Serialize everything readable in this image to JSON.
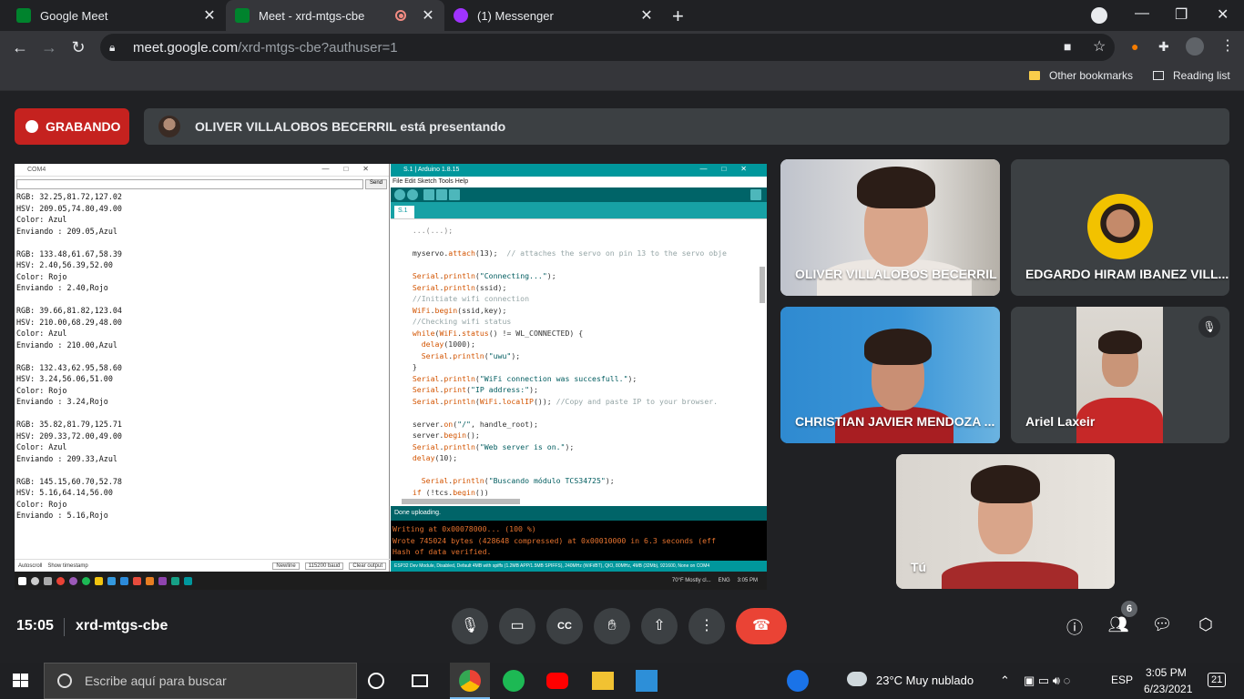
{
  "browser": {
    "tabs": [
      {
        "title": "Google Meet",
        "active": false
      },
      {
        "title": "Meet - xrd-mtgs-cbe",
        "active": true
      },
      {
        "title": "(1) Messenger",
        "active": false
      }
    ],
    "url_host": "meet.google.com",
    "url_path": "/xrd-mtgs-cbe?authuser=1",
    "bookmarks": {
      "other": "Other bookmarks",
      "reading_list": "Reading list"
    }
  },
  "meet": {
    "recording_label": "GRABANDO",
    "presenting_text": "OLIVER VILLALOBOS BECERRIL está presentando",
    "time": "15:05",
    "meeting_code": "xrd-mtgs-cbe",
    "participant_count": "6",
    "participants": [
      {
        "name": "OLIVER VILLALOBOS BECERRIL"
      },
      {
        "name": "EDGARDO HIRAM IBANEZ VILL..."
      },
      {
        "name": "CHRISTIAN JAVIER MENDOZA ..."
      },
      {
        "name": "Ariel Laxeir"
      },
      {
        "name": "Tú"
      }
    ],
    "colors": {
      "record_red": "#c5221f",
      "end_call": "#ea4335"
    }
  },
  "shared_screen": {
    "serial_title": "COM4",
    "send_label": "Send",
    "serial_output": "RGB: 32.25,81.72,127.02\nHSV: 209.05,74.80,49.00\nColor: Azul\nEnviando : 209.05,Azul\n\nRGB: 133.48,61.67,58.39\nHSV: 2.40,56.39,52.00\nColor: Rojo\nEnviando : 2.40,Rojo\n\nRGB: 39.66,81.82,123.04\nHSV: 210.00,68.29,48.00\nColor: Azul\nEnviando : 210.00,Azul\n\nRGB: 132.43,62.95,58.60\nHSV: 3.24,56.06,51.00\nColor: Rojo\nEnviando : 3.24,Rojo\n\nRGB: 35.82,81.79,125.71\nHSV: 209.33,72.00,49.00\nColor: Azul\nEnviando : 209.33,Azul\n\nRGB: 145.15,60.70,52.78\nHSV: 5.16,64.14,56.00\nColor: Rojo\nEnviando : 5.16,Rojo",
    "serial_footer": {
      "autoscroll": "Autoscroll",
      "timestamp": "Show timestamp",
      "newline": "Newline",
      "baud": "115200 baud",
      "clear": "Clear output"
    },
    "ide_title": "S.1 | Arduino 1.8.15",
    "ide_menu": "File  Edit  Sketch  Tools  Help",
    "ide_tab": "S.1",
    "ide_status": "Done uploading.",
    "console_output": "Writing at 0x00078000... (100 %)\nWrote 745024 bytes (428648 compressed) at 0x00010000 in 6.3 seconds (eff\nHash of data verified.",
    "ide_bottom": "ESP32 Dev Module, Disabled, Default 4MB with spiffs (1.2MB APP/1.5MB SPIFFS), 240MHz (WiFi/BT), QIO, 80MHz, 4MB (32Mb), 921600, None on COM4",
    "taskbar_weather": "70°F  Mostly cl...",
    "taskbar_lang": "ENG",
    "taskbar_time": "3:05 PM"
  },
  "windows": {
    "search_placeholder": "Escribe aquí para buscar",
    "weather": "23°C  Muy nublado",
    "lang": "ESP",
    "time": "3:05 PM",
    "date": "6/23/2021",
    "notifications": "21"
  }
}
